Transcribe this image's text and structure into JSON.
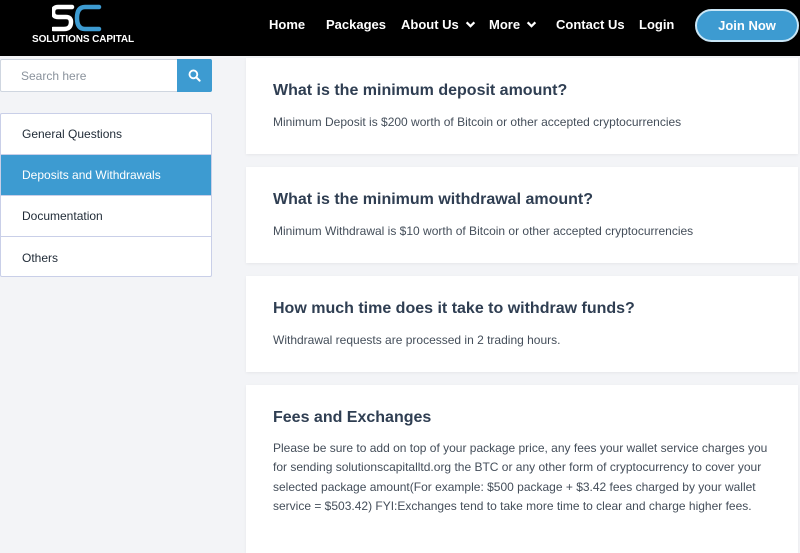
{
  "header": {
    "logo_text": "SOLUTIONS CAPITAL",
    "logo_monogram": "SC",
    "nav": [
      {
        "label": "Home",
        "has_dropdown": false
      },
      {
        "label": "Packages",
        "has_dropdown": false
      },
      {
        "label": "About Us",
        "has_dropdown": true
      },
      {
        "label": "More",
        "has_dropdown": true
      },
      {
        "label": "Contact Us",
        "has_dropdown": false
      },
      {
        "label": "Login",
        "has_dropdown": false
      }
    ],
    "join_label": "Join Now"
  },
  "sidebar": {
    "search": {
      "placeholder": "Search here",
      "value": "",
      "icon": "search-icon"
    },
    "items": [
      {
        "label": "General Questions",
        "active": false
      },
      {
        "label": "Deposits and Withdrawals",
        "active": true
      },
      {
        "label": "Documentation",
        "active": false
      },
      {
        "label": "Others",
        "active": false
      }
    ]
  },
  "faqs": [
    {
      "question": "What is the minimum deposit amount?",
      "answer": "Minimum Deposit is $200 worth of Bitcoin or other accepted cryptocurrencies"
    },
    {
      "question": "What is the minimum withdrawal amount?",
      "answer": "Minimum Withdrawal is $10 worth of Bitcoin or other accepted cryptocurrencies"
    },
    {
      "question": "How much time does it take to withdraw funds?",
      "answer": "Withdrawal requests are processed in 2 trading hours."
    },
    {
      "question": "Fees and Exchanges",
      "answer": "Please be sure to add on top of your package price, any fees your wallet service charges you for sending solutionscapitalltd.org the BTC or any other form of cryptocurrency to cover your selected package amount(For example: $500 package + $3.42 fees charged by your wallet service = $503.42) FYI:Exchanges tend to take more time to clear and charge higher fees."
    }
  ],
  "colors": {
    "accent": "#3d9bd1",
    "header_bg": "#000000",
    "page_bg": "#f3f4f7"
  }
}
